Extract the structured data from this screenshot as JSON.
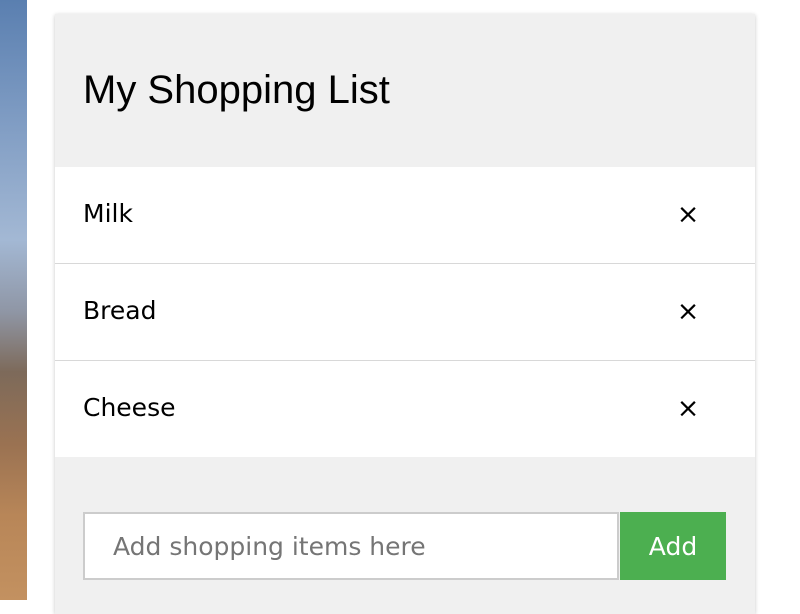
{
  "app": {
    "title": "My Shopping List"
  },
  "items": [
    {
      "label": "Milk",
      "remove_label": "×"
    },
    {
      "label": "Bread",
      "remove_label": "×"
    },
    {
      "label": "Cheese",
      "remove_label": "×"
    }
  ],
  "add_form": {
    "input_value": "",
    "placeholder": "Add shopping items here",
    "button_label": "Add"
  },
  "colors": {
    "panel_background": "#f0f0f0",
    "item_background": "#ffffff",
    "add_button": "#4caf50"
  },
  "icons": {
    "remove": "close-icon"
  }
}
